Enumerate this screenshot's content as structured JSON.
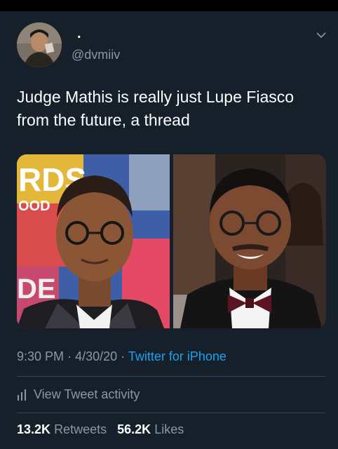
{
  "header": {
    "display_name": ".",
    "handle": "@dvmiiv"
  },
  "tweet": {
    "text": "Judge Mathis is really just Lupe Fiasco from the future, a thread",
    "time": "9:30 PM",
    "date": "4/30/20",
    "source": "Twitter for iPhone",
    "separator": "·"
  },
  "media": {
    "left_banner_text": "RDS",
    "left_banner_sub": "OOD",
    "left_banner_bottom": "DE"
  },
  "activity": {
    "label": "View Tweet activity"
  },
  "stats": {
    "retweets_count": "13.2K",
    "retweets_label": "Retweets",
    "likes_count": "56.2K",
    "likes_label": "Likes"
  },
  "colors": {
    "background": "#15202b",
    "secondary_text": "#8899a6",
    "link": "#1da1f2",
    "divider": "#38444d"
  }
}
